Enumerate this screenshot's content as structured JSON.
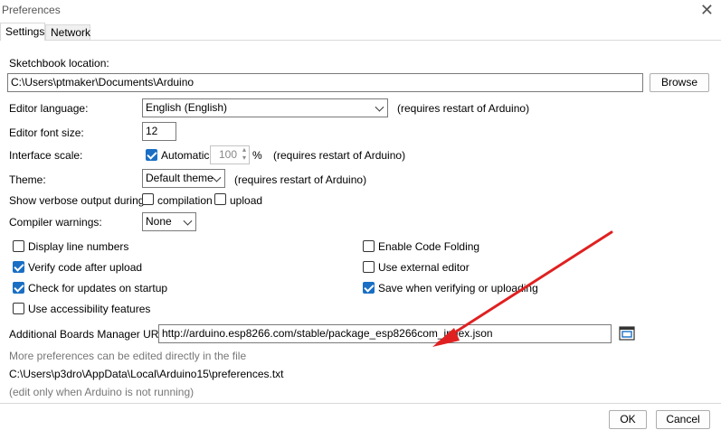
{
  "window": {
    "title": "Preferences"
  },
  "tabs": [
    {
      "label": "Settings"
    },
    {
      "label": "Network"
    }
  ],
  "settings": {
    "sketchbook_label": "Sketchbook location:",
    "sketchbook_value": "C:\\Users\\ptmaker\\Documents\\Arduino",
    "browse_label": "Browse",
    "language_label": "Editor language:",
    "language_value": "English (English)",
    "language_note": "(requires restart of Arduino)",
    "font_size_label": "Editor font size:",
    "font_size_value": "12",
    "scale_label": "Interface scale:",
    "scale_auto_label": "Automatic",
    "scale_auto_checked": true,
    "scale_value": "100",
    "scale_unit": "%",
    "scale_note": "(requires restart of Arduino)",
    "theme_label": "Theme:",
    "theme_value": "Default theme",
    "theme_note": "(requires restart of Arduino)",
    "verbose_label": "Show verbose output during:",
    "verbose_compilation": "compilation",
    "verbose_upload": "upload",
    "warnings_label": "Compiler warnings:",
    "warnings_value": "None",
    "checkboxes": [
      {
        "label": "Display line numbers",
        "checked": false
      },
      {
        "label": "Verify code after upload",
        "checked": true
      },
      {
        "label": "Check for updates on startup",
        "checked": true
      },
      {
        "label": "Use accessibility features",
        "checked": false
      },
      {
        "label": "Enable Code Folding",
        "checked": false
      },
      {
        "label": "Use external editor",
        "checked": false
      },
      {
        "label": "Save when verifying or uploading",
        "checked": true
      }
    ],
    "boards_label": "Additional Boards Manager URLs:",
    "boards_value": "http://arduino.esp8266.com/stable/package_esp8266com_index.json",
    "more_prefs_note": "More preferences can be edited directly in the file",
    "prefs_path": "C:\\Users\\p3dro\\AppData\\Local\\Arduino15\\preferences.txt",
    "edit_note": "(edit only when Arduino is not running)"
  },
  "footer": {
    "ok_label": "OK",
    "cancel_label": "Cancel"
  },
  "icons": {
    "close": "close-icon",
    "window_edit": "window-edit-icon",
    "chevron": "chevron-down-icon",
    "annotation": "red-arrow"
  },
  "colors": {
    "accent": "#1a6fc4",
    "arrow": "#e02020"
  }
}
